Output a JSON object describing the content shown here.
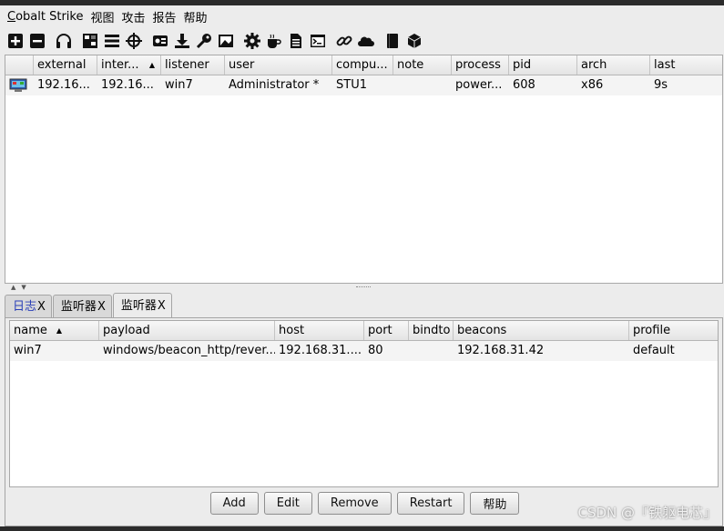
{
  "menu": [
    {
      "first": "C",
      "rest": "obalt Strike"
    },
    {
      "first": "",
      "rest": "视图"
    },
    {
      "first": "",
      "rest": "攻击"
    },
    {
      "first": "",
      "rest": "报告"
    },
    {
      "first": "",
      "rest": "帮助"
    }
  ],
  "toolbar_icons": [
    "plus-icon",
    "minus-icon",
    "headphones-icon",
    "network-icon",
    "list-icon",
    "crosshair-icon",
    "screenshot-icon",
    "download-icon",
    "key-icon",
    "image-icon",
    "gear-icon",
    "coffee-icon",
    "document-icon",
    "console-icon",
    "link-icon",
    "cloud-icon",
    "book-icon",
    "cube-icon"
  ],
  "beacons": {
    "columns": [
      "",
      "external",
      "inter...",
      "listener",
      "user",
      "compu...",
      "note",
      "process",
      "pid",
      "arch",
      "last"
    ],
    "sorted_column": "inter...",
    "rows": [
      [
        "",
        "192.16...",
        "192.16...",
        "win7",
        "Administrator *",
        "STU1",
        "",
        "power...",
        "608",
        "x86",
        "9s"
      ]
    ]
  },
  "tabs": [
    {
      "label": "日志",
      "close": "X",
      "active": false
    },
    {
      "label": "监听器",
      "close": "X",
      "active": false
    },
    {
      "label": "监听器",
      "close": "X",
      "active": true
    }
  ],
  "listeners": {
    "columns": [
      "name",
      "payload",
      "host",
      "port",
      "bindto",
      "beacons",
      "profile"
    ],
    "sorted_column": "name",
    "rows": [
      [
        "win7",
        "windows/beacon_http/rever...",
        "192.168.31....",
        "80",
        "",
        "192.168.31.42",
        "default"
      ]
    ]
  },
  "buttons": {
    "add": "Add",
    "edit": "Edit",
    "remove": "Remove",
    "restart": "Restart",
    "help": "帮助"
  },
  "watermark": "CSDN @『铁躯电芯』"
}
